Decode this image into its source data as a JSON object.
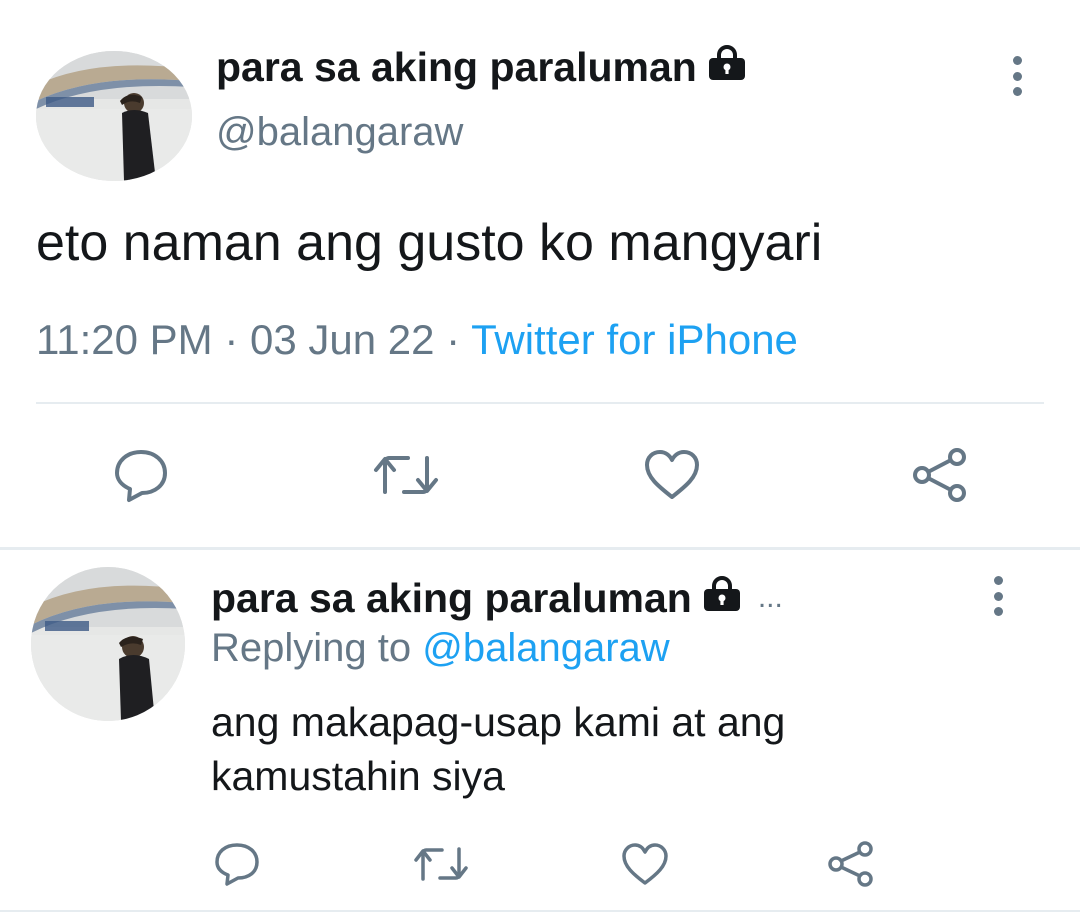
{
  "main_tweet": {
    "display_name": "para sa aking paraluman",
    "handle": "@balangaraw",
    "text": "eto naman ang gusto ko mangyari",
    "time": "11:20 PM",
    "sep1": "·",
    "date": "03 Jun 22",
    "sep2": "·",
    "source": "Twitter for iPhone",
    "actions": [
      "reply-icon",
      "retweet-icon",
      "like-icon",
      "share-icon"
    ]
  },
  "reply_tweet": {
    "display_name": "para sa aking paraluman",
    "truncation": "...",
    "replying_prefix": "Replying to",
    "replying_handle": "@balangaraw",
    "text": "ang makapag-usap kami at ang kamustahin siya",
    "actions": [
      "reply-icon",
      "retweet-icon",
      "like-icon",
      "share-icon"
    ]
  },
  "colors": {
    "text": "#14171a",
    "secondary": "#657786",
    "accent": "#1da1f2",
    "divider": "#e6ecf0"
  }
}
